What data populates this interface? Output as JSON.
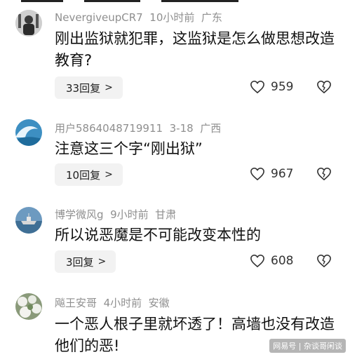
{
  "comments": [
    {
      "username": "NevergiveupCR7",
      "time": "10小时前",
      "location": "广东",
      "text": "刚出监狱就犯罪，这监狱是怎么做思想改造教育?",
      "replies": "33回复",
      "likes": "959"
    },
    {
      "username": "用户5864048719911",
      "time": "3-18",
      "location": "广西",
      "text": "注意这三个字“刚出狱”",
      "replies": "10回复",
      "likes": "967"
    },
    {
      "username": "博学微风g",
      "time": "9小时前",
      "location": "甘肃",
      "text": "所以说恶魔是不可能改变本性的",
      "replies": "3回复",
      "likes": "608"
    },
    {
      "username": "飚王安哥",
      "time": "4小时前",
      "location": "安徽",
      "text": "一个恶人根子里就坏透了！高墙也没有改造他们的恶!"
    }
  ],
  "watermark": "网易号 | 杂谈哥闲谈",
  "colors": {
    "meta": "#8f8f8f",
    "reply_bg": "#f2f2f2",
    "text": "#111111"
  }
}
